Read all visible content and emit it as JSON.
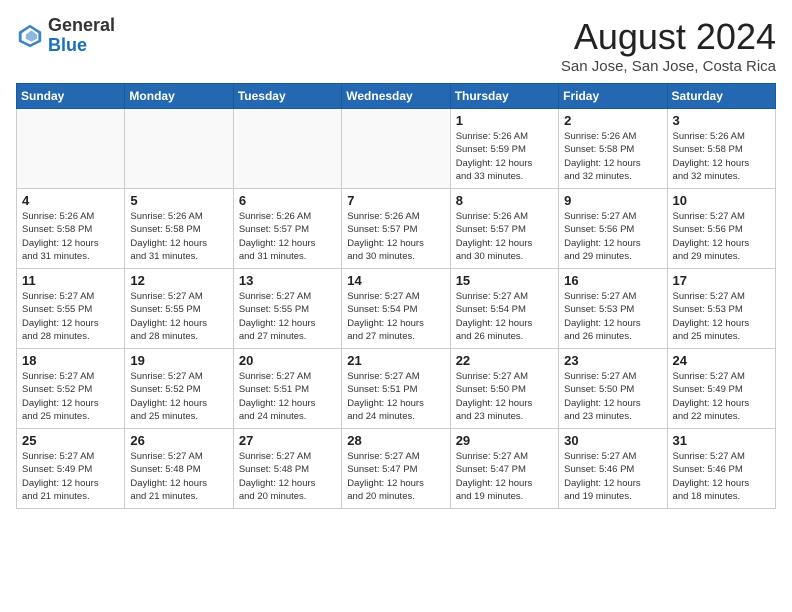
{
  "header": {
    "logo_general": "General",
    "logo_blue": "Blue",
    "title": "August 2024",
    "subtitle": "San Jose, San Jose, Costa Rica"
  },
  "days_of_week": [
    "Sunday",
    "Monday",
    "Tuesday",
    "Wednesday",
    "Thursday",
    "Friday",
    "Saturday"
  ],
  "weeks": [
    [
      {
        "day": "",
        "info": "",
        "empty": true
      },
      {
        "day": "",
        "info": "",
        "empty": true
      },
      {
        "day": "",
        "info": "",
        "empty": true
      },
      {
        "day": "",
        "info": "",
        "empty": true
      },
      {
        "day": "1",
        "info": "Sunrise: 5:26 AM\nSunset: 5:59 PM\nDaylight: 12 hours\nand 33 minutes."
      },
      {
        "day": "2",
        "info": "Sunrise: 5:26 AM\nSunset: 5:58 PM\nDaylight: 12 hours\nand 32 minutes."
      },
      {
        "day": "3",
        "info": "Sunrise: 5:26 AM\nSunset: 5:58 PM\nDaylight: 12 hours\nand 32 minutes."
      }
    ],
    [
      {
        "day": "4",
        "info": "Sunrise: 5:26 AM\nSunset: 5:58 PM\nDaylight: 12 hours\nand 31 minutes."
      },
      {
        "day": "5",
        "info": "Sunrise: 5:26 AM\nSunset: 5:58 PM\nDaylight: 12 hours\nand 31 minutes."
      },
      {
        "day": "6",
        "info": "Sunrise: 5:26 AM\nSunset: 5:57 PM\nDaylight: 12 hours\nand 31 minutes."
      },
      {
        "day": "7",
        "info": "Sunrise: 5:26 AM\nSunset: 5:57 PM\nDaylight: 12 hours\nand 30 minutes."
      },
      {
        "day": "8",
        "info": "Sunrise: 5:26 AM\nSunset: 5:57 PM\nDaylight: 12 hours\nand 30 minutes."
      },
      {
        "day": "9",
        "info": "Sunrise: 5:27 AM\nSunset: 5:56 PM\nDaylight: 12 hours\nand 29 minutes."
      },
      {
        "day": "10",
        "info": "Sunrise: 5:27 AM\nSunset: 5:56 PM\nDaylight: 12 hours\nand 29 minutes."
      }
    ],
    [
      {
        "day": "11",
        "info": "Sunrise: 5:27 AM\nSunset: 5:55 PM\nDaylight: 12 hours\nand 28 minutes."
      },
      {
        "day": "12",
        "info": "Sunrise: 5:27 AM\nSunset: 5:55 PM\nDaylight: 12 hours\nand 28 minutes."
      },
      {
        "day": "13",
        "info": "Sunrise: 5:27 AM\nSunset: 5:55 PM\nDaylight: 12 hours\nand 27 minutes."
      },
      {
        "day": "14",
        "info": "Sunrise: 5:27 AM\nSunset: 5:54 PM\nDaylight: 12 hours\nand 27 minutes."
      },
      {
        "day": "15",
        "info": "Sunrise: 5:27 AM\nSunset: 5:54 PM\nDaylight: 12 hours\nand 26 minutes."
      },
      {
        "day": "16",
        "info": "Sunrise: 5:27 AM\nSunset: 5:53 PM\nDaylight: 12 hours\nand 26 minutes."
      },
      {
        "day": "17",
        "info": "Sunrise: 5:27 AM\nSunset: 5:53 PM\nDaylight: 12 hours\nand 25 minutes."
      }
    ],
    [
      {
        "day": "18",
        "info": "Sunrise: 5:27 AM\nSunset: 5:52 PM\nDaylight: 12 hours\nand 25 minutes."
      },
      {
        "day": "19",
        "info": "Sunrise: 5:27 AM\nSunset: 5:52 PM\nDaylight: 12 hours\nand 25 minutes."
      },
      {
        "day": "20",
        "info": "Sunrise: 5:27 AM\nSunset: 5:51 PM\nDaylight: 12 hours\nand 24 minutes."
      },
      {
        "day": "21",
        "info": "Sunrise: 5:27 AM\nSunset: 5:51 PM\nDaylight: 12 hours\nand 24 minutes."
      },
      {
        "day": "22",
        "info": "Sunrise: 5:27 AM\nSunset: 5:50 PM\nDaylight: 12 hours\nand 23 minutes."
      },
      {
        "day": "23",
        "info": "Sunrise: 5:27 AM\nSunset: 5:50 PM\nDaylight: 12 hours\nand 23 minutes."
      },
      {
        "day": "24",
        "info": "Sunrise: 5:27 AM\nSunset: 5:49 PM\nDaylight: 12 hours\nand 22 minutes."
      }
    ],
    [
      {
        "day": "25",
        "info": "Sunrise: 5:27 AM\nSunset: 5:49 PM\nDaylight: 12 hours\nand 21 minutes."
      },
      {
        "day": "26",
        "info": "Sunrise: 5:27 AM\nSunset: 5:48 PM\nDaylight: 12 hours\nand 21 minutes."
      },
      {
        "day": "27",
        "info": "Sunrise: 5:27 AM\nSunset: 5:48 PM\nDaylight: 12 hours\nand 20 minutes."
      },
      {
        "day": "28",
        "info": "Sunrise: 5:27 AM\nSunset: 5:47 PM\nDaylight: 12 hours\nand 20 minutes."
      },
      {
        "day": "29",
        "info": "Sunrise: 5:27 AM\nSunset: 5:47 PM\nDaylight: 12 hours\nand 19 minutes."
      },
      {
        "day": "30",
        "info": "Sunrise: 5:27 AM\nSunset: 5:46 PM\nDaylight: 12 hours\nand 19 minutes."
      },
      {
        "day": "31",
        "info": "Sunrise: 5:27 AM\nSunset: 5:46 PM\nDaylight: 12 hours\nand 18 minutes."
      }
    ]
  ]
}
